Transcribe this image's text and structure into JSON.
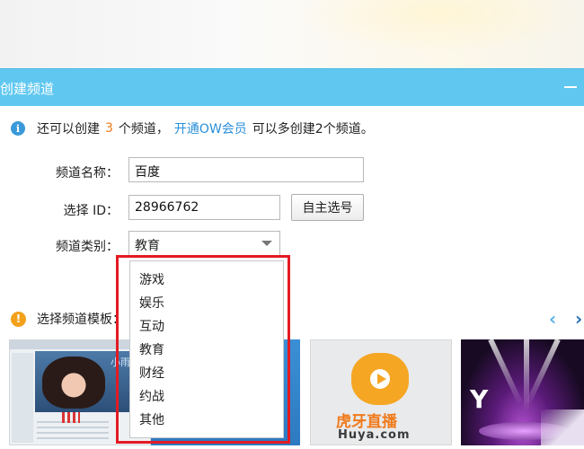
{
  "dialog": {
    "title": "创建频道",
    "minimize_icon": "minimize-icon"
  },
  "info": {
    "prefix": "还可以创建",
    "count": "3",
    "unit": "个频道，",
    "link": "开通OW会员",
    "suffix": "可以多创建2个频道。"
  },
  "form": {
    "name_label": "频道名称：",
    "name_value": "百度",
    "id_label": "选择 ID：",
    "id_value": "28966762",
    "self_select_button": "自主选号",
    "category_label": "频道类别：",
    "category_value": "教育"
  },
  "dropdown": {
    "options": [
      "游戏",
      "娱乐",
      "互动",
      "教育",
      "财经",
      "约战",
      "其他"
    ]
  },
  "templates": {
    "label": "选择频道模板：",
    "nav_prev": "‹",
    "nav_next": "›",
    "thumb1_text": "小雨",
    "thumb3_brand": "虎牙直播",
    "thumb3_domain": "Huya.com",
    "thumb4_text": "Y"
  },
  "colors": {
    "titlebar": "#60c8f0",
    "accent_link": "#2a8fd8",
    "count_orange": "#f07a1a",
    "highlight_red": "#e31b23"
  }
}
